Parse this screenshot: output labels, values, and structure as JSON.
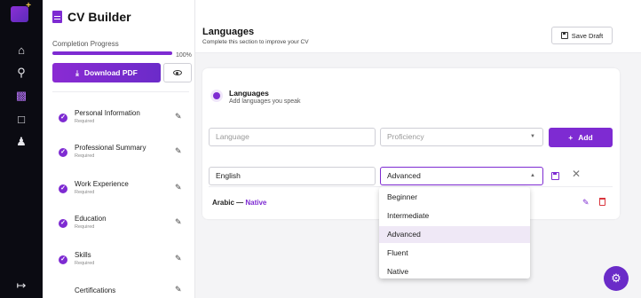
{
  "sidebar": {
    "title": "CV Builder",
    "progress_label": "Completion Progress",
    "progress_value": 100,
    "progress_text": "100%",
    "download_label": "Download PDF",
    "sections": [
      {
        "label": "Personal Information",
        "status": "Required"
      },
      {
        "label": "Professional Summary",
        "status": "Required"
      },
      {
        "label": "Work Experience",
        "status": "Required"
      },
      {
        "label": "Education",
        "status": "Required"
      },
      {
        "label": "Skills",
        "status": "Required"
      },
      {
        "label": "Certifications",
        "status": ""
      }
    ]
  },
  "header": {
    "title": "Languages",
    "subtitle": "Complete this section to improve your CV",
    "save_label": "Save Draft"
  },
  "card": {
    "title": "Languages",
    "subtitle": "Add languages you speak",
    "language_placeholder": "Language",
    "proficiency_placeholder": "Proficiency",
    "add_label": "Add",
    "edit_language": "English",
    "edit_proficiency": "Advanced",
    "entry_language": "Arabic",
    "entry_separator": " — ",
    "entry_level": "Native"
  },
  "dropdown": {
    "options": [
      "Beginner",
      "Intermediate",
      "Advanced",
      "Fluent",
      "Native"
    ],
    "selected": "Advanced"
  },
  "colors": {
    "accent": "#7e2bd2",
    "danger": "#d9363e"
  }
}
